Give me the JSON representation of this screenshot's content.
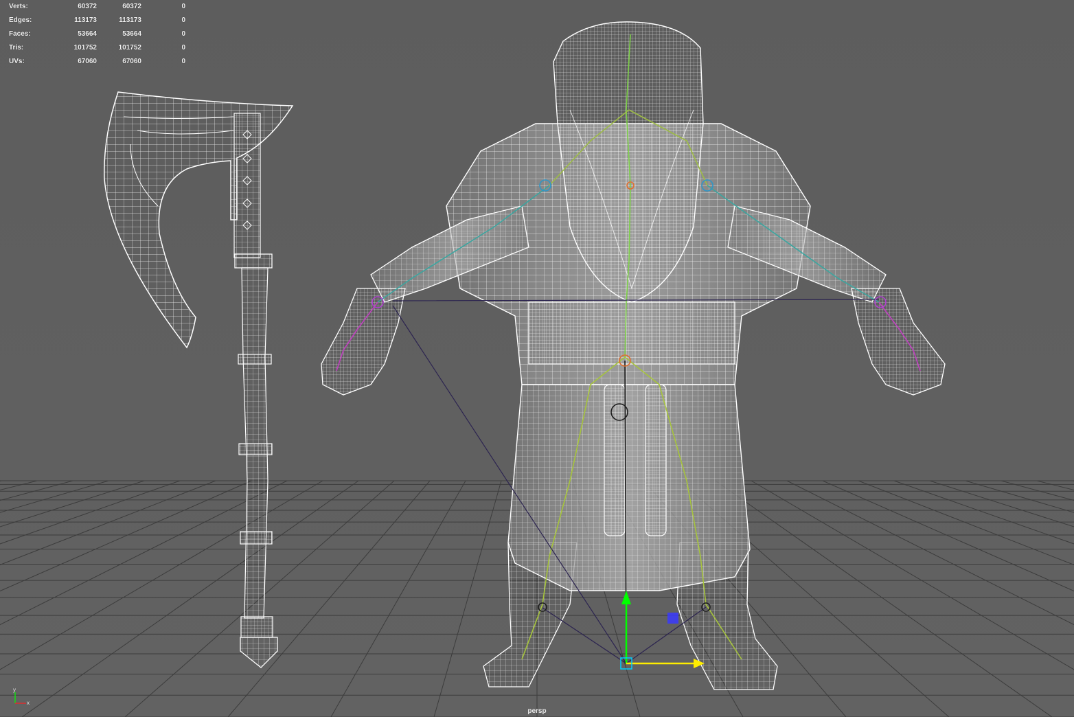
{
  "viewport": {
    "camera": "persp",
    "background": "#5f5f5f",
    "wire_color": "#ffffff",
    "grid_color": "#3c3c3c"
  },
  "hud": {
    "rows": [
      {
        "label": "Verts:",
        "v1": "60372",
        "v2": "60372",
        "v3": "0"
      },
      {
        "label": "Edges:",
        "v1": "113173",
        "v2": "113173",
        "v3": "0"
      },
      {
        "label": "Faces:",
        "v1": "53664",
        "v2": "53664",
        "v3": "0"
      },
      {
        "label": "Tris:",
        "v1": "101752",
        "v2": "101752",
        "v3": "0"
      },
      {
        "label": "UVs:",
        "v1": "67060",
        "v2": "67060",
        "v3": "0"
      }
    ]
  },
  "gizmo": {
    "y_axis_color": "#00ff00",
    "x_axis_color": "#ffee00",
    "handle_color": "#3a3aff",
    "axis_y_label": "y",
    "axis_x_label": "x"
  },
  "objects": [
    {
      "name": "axe",
      "icon": "axe-icon"
    },
    {
      "name": "dwarf-character",
      "icon": "character-icon"
    }
  ]
}
